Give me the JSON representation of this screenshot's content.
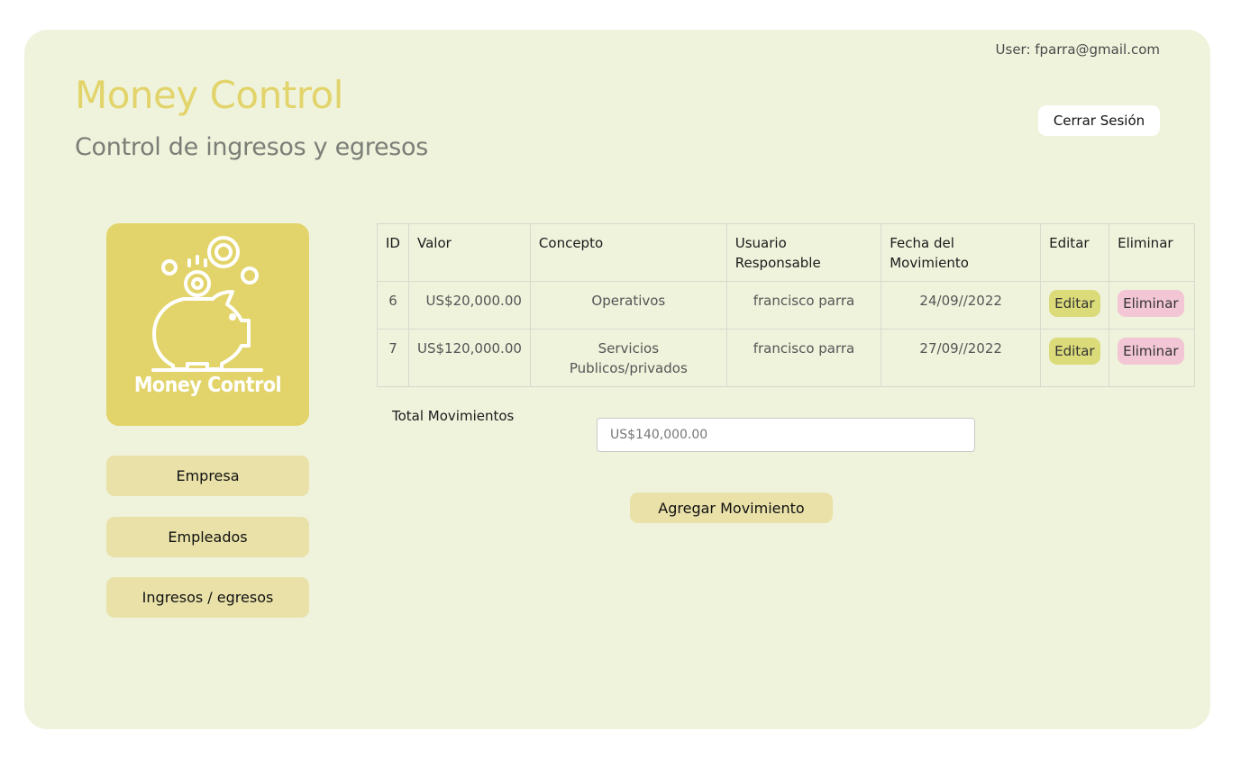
{
  "header": {
    "user_label": "User: fparra@gmail.com",
    "title": "Money Control",
    "subtitle": "Control de ingresos y egresos",
    "logout_label": "Cerrar Sesión"
  },
  "logo": {
    "text": "Money Control",
    "icon": "piggy-bank-icon"
  },
  "nav": {
    "items": [
      {
        "label": "Empresa"
      },
      {
        "label": "Empleados"
      },
      {
        "label": "Ingresos / egresos"
      }
    ]
  },
  "table": {
    "headers": {
      "id": "ID",
      "valor": "Valor",
      "concepto": "Concepto",
      "usuario": "Usuario Responsable",
      "fecha": "Fecha del Movimiento",
      "editar": "Editar",
      "eliminar": "Eliminar"
    },
    "rows": [
      {
        "id": "6",
        "valor": "US$20,000.00",
        "concepto": "Operativos",
        "usuario": "francisco parra",
        "fecha": "24/09//2022",
        "edit_label": "Editar",
        "delete_label": "Eliminar"
      },
      {
        "id": "7",
        "valor": "US$120,000.00",
        "concepto": "Servicios Publicos/privados",
        "usuario": "francisco parra",
        "fecha": "27/09//2022",
        "edit_label": "Editar",
        "delete_label": "Eliminar"
      }
    ]
  },
  "total": {
    "label": "Total Movimientos",
    "value": "US$140,000.00"
  },
  "add_label": "Agregar Movimiento",
  "colors": {
    "panel_bg": "#eff3dc",
    "brand_yellow": "#e2d46a",
    "nav_button": "#e9e1a8",
    "edit_pill": "#dbdb7a",
    "delete_pill": "#f2c6d4"
  }
}
